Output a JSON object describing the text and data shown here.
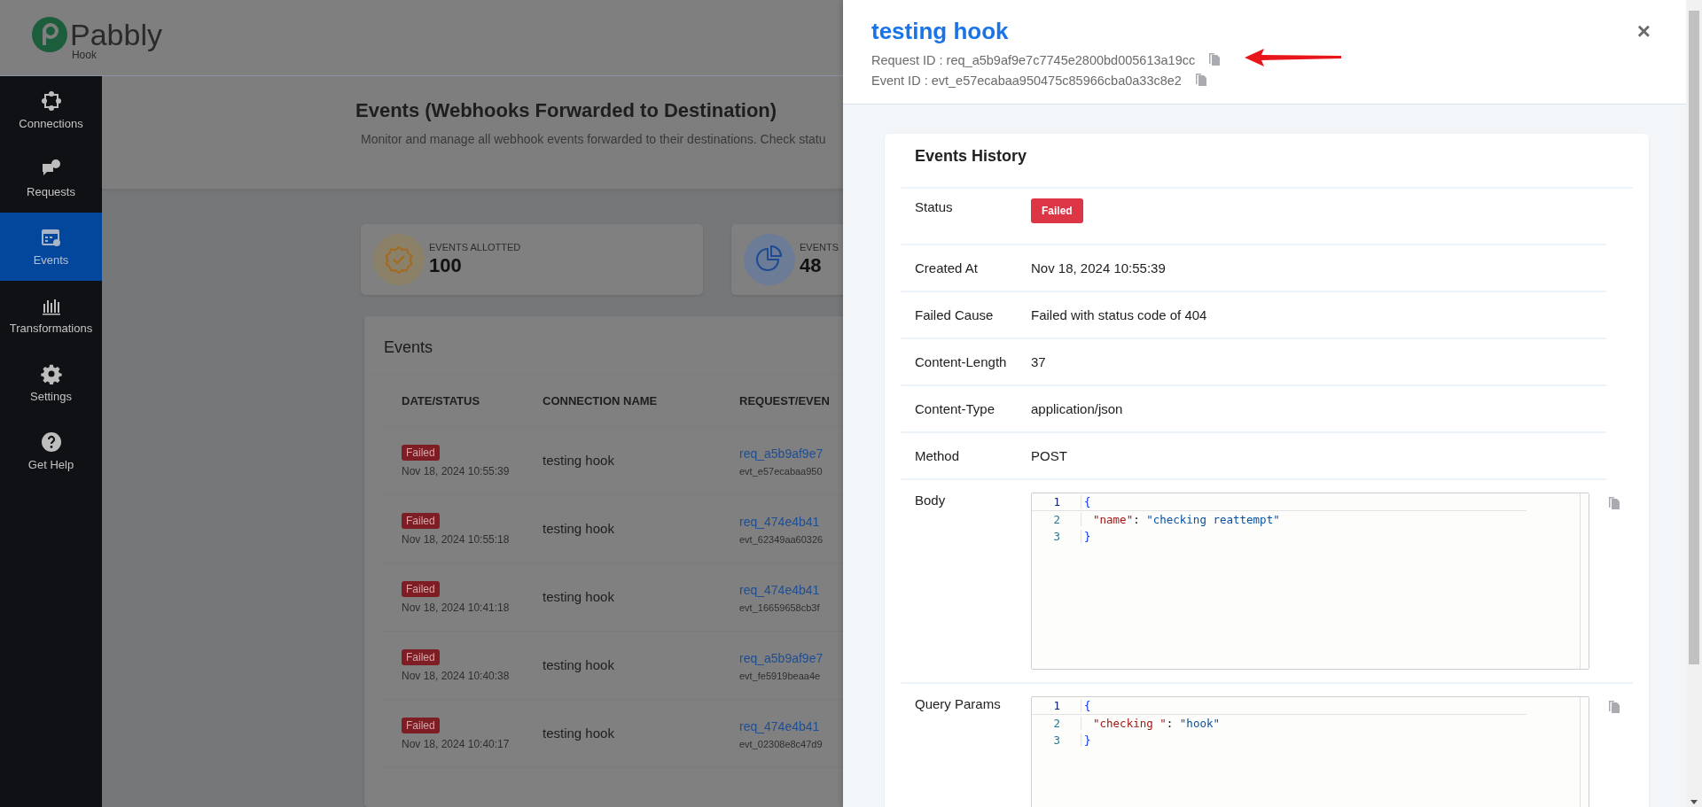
{
  "brand": {
    "name": "Pabbly",
    "product": "Hook"
  },
  "sidebar": {
    "items": [
      {
        "label": "Connections",
        "selected": false
      },
      {
        "label": "Requests",
        "selected": false
      },
      {
        "label": "Events",
        "selected": true
      },
      {
        "label": "Transformations",
        "selected": false
      },
      {
        "label": "Settings",
        "selected": false
      },
      {
        "label": "Get Help",
        "selected": false
      }
    ]
  },
  "page": {
    "title": "Events (Webhooks Forwarded to Destination)",
    "description": "Monitor and manage all webhook events forwarded to their destinations. Check statu"
  },
  "stats": [
    {
      "label": "EVENTS ALLOTTED",
      "value": "100"
    },
    {
      "label": "EVENTS",
      "value": "48"
    }
  ],
  "events_table": {
    "title": "Events",
    "columns": [
      "DATE/STATUS",
      "CONNECTION NAME",
      "REQUEST/EVEN"
    ],
    "rows": [
      {
        "status": "Failed",
        "date": "Nov 18, 2024 10:55:39",
        "connection": "testing hook",
        "request_id": "req_a5b9af9e7",
        "event_id": "evt_e57ecabaa950"
      },
      {
        "status": "Failed",
        "date": "Nov 18, 2024 10:55:18",
        "connection": "testing hook",
        "request_id": "req_474e4b41",
        "event_id": "evt_62349aa60326"
      },
      {
        "status": "Failed",
        "date": "Nov 18, 2024 10:41:18",
        "connection": "testing hook",
        "request_id": "req_474e4b41",
        "event_id": "evt_16659658cb3f"
      },
      {
        "status": "Failed",
        "date": "Nov 18, 2024 10:40:38",
        "connection": "testing hook",
        "request_id": "req_a5b9af9e7",
        "event_id": "evt_fe5919beaa4e"
      },
      {
        "status": "Failed",
        "date": "Nov 18, 2024 10:40:17",
        "connection": "testing hook",
        "request_id": "req_474e4b41",
        "event_id": "evt_02308e8c47d9"
      }
    ]
  },
  "drawer": {
    "title": "testing hook",
    "close": "×",
    "request_id": "Request ID : req_a5b9af9e7c7745e2800bd005613a19cc",
    "event_id": "Event ID : evt_e57ecabaa950475c85966cba0a33c8e2",
    "history": {
      "title": "Events History",
      "rows": [
        {
          "kind": "badge",
          "label": "Status",
          "value": "Failed"
        },
        {
          "kind": "text",
          "label": "Created At",
          "value": "Nov 18, 2024 10:55:39"
        },
        {
          "kind": "text",
          "label": "Failed Cause",
          "value": "Failed with status code of 404"
        },
        {
          "kind": "text",
          "label": "Content-Length",
          "value": "37"
        },
        {
          "kind": "text",
          "label": "Content-Type",
          "value": "application/json"
        },
        {
          "kind": "text",
          "label": "Method",
          "value": "POST"
        },
        {
          "kind": "code",
          "label": "Body",
          "lines": [
            {
              "number": "1",
              "tokens": [
                {
                  "kind": "punct",
                  "text": "{"
                }
              ]
            },
            {
              "number": "2",
              "tokens": [
                {
                  "kind": "key",
                  "text": "\"name\""
                },
                {
                  "kind": "punct",
                  "text": ":"
                },
                {
                  "kind": "string",
                  "text": "\"checking reattempt\""
                }
              ]
            },
            {
              "number": "3",
              "tokens": [
                {
                  "kind": "punct",
                  "text": "}"
                }
              ]
            }
          ]
        },
        {
          "kind": "code",
          "label": "Query Params",
          "lines": [
            {
              "number": "1",
              "tokens": [
                {
                  "kind": "punct",
                  "text": "{"
                }
              ]
            },
            {
              "number": "2",
              "tokens": [
                {
                  "kind": "key",
                  "text": "\"checking \""
                },
                {
                  "kind": "punct",
                  "text": ":"
                },
                {
                  "kind": "string",
                  "text": "\"hook\""
                }
              ]
            },
            {
              "number": "3",
              "tokens": [
                {
                  "kind": "punct",
                  "text": "}"
                }
              ]
            }
          ]
        }
      ]
    }
  }
}
